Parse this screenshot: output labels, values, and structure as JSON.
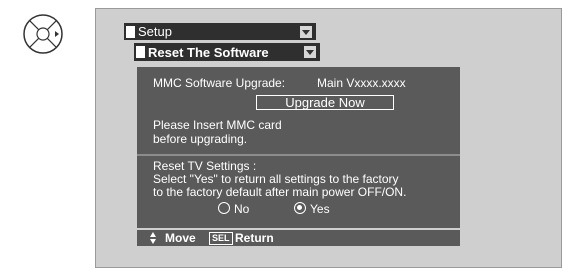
{
  "remote_icon": "remote-dpad-right-icon",
  "menu": {
    "setup_label": "Setup",
    "reset_label": "Reset The Software"
  },
  "mmc": {
    "label": "MMC Software Upgrade:",
    "version": "Main Vxxxx.xxxx",
    "upgrade_button": "Upgrade Now",
    "instruction_line1": "Please Insert MMC card",
    "instruction_line2": "before upgrading."
  },
  "reset_tv": {
    "title": "Reset TV Settings :",
    "line1": "Select \"Yes\" to return all settings to the factory",
    "line2": "to the factory default after main power OFF/ON.",
    "options": [
      {
        "label": "No",
        "selected": false
      },
      {
        "label": "Yes",
        "selected": true
      }
    ]
  },
  "footer": {
    "move_label": "Move",
    "sel_key": "SEL",
    "return_label": "Return"
  },
  "colors": {
    "panel_bg": "#cfcfcf",
    "content_bg": "#5a5a5a",
    "bar_bg": "#2f2f2f"
  }
}
